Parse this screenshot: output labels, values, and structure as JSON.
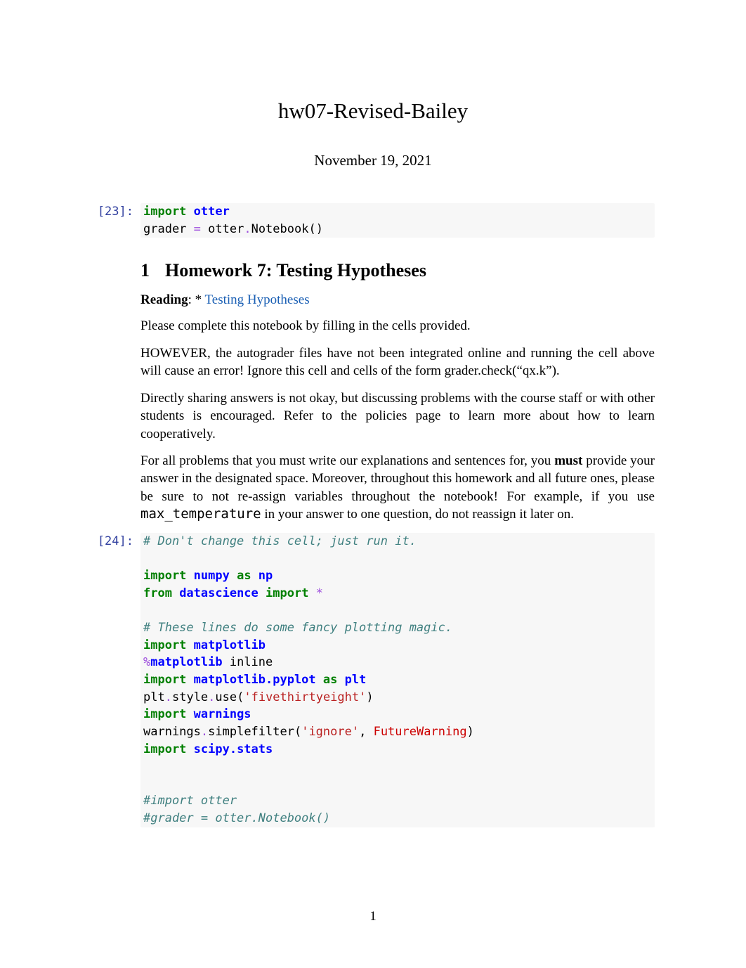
{
  "title": "hw07-Revised-Bailey",
  "date": "November 19, 2021",
  "cells": [
    {
      "prompt": "[23]:",
      "lines": [
        {
          "segs": [
            {
              "t": "import ",
              "c": "kw-green"
            },
            {
              "t": "otter",
              "c": "name-blue"
            }
          ]
        },
        {
          "segs": [
            {
              "t": "grader "
            },
            {
              "t": "=",
              "c": "op-purple"
            },
            {
              "t": " otter"
            },
            {
              "t": ".",
              "c": "op-purple"
            },
            {
              "t": "Notebook()"
            }
          ]
        }
      ]
    },
    {
      "prompt": "[24]:",
      "lines": [
        {
          "segs": [
            {
              "t": "# Don't change this cell; just run it.",
              "c": "comment-it"
            }
          ]
        },
        {
          "segs": [
            {
              "t": ""
            }
          ]
        },
        {
          "segs": [
            {
              "t": "import ",
              "c": "kw-green"
            },
            {
              "t": "numpy ",
              "c": "name-blue"
            },
            {
              "t": "as ",
              "c": "kw-green"
            },
            {
              "t": "np",
              "c": "name-blue"
            }
          ]
        },
        {
          "segs": [
            {
              "t": "from ",
              "c": "kw-green"
            },
            {
              "t": "datascience ",
              "c": "name-blue"
            },
            {
              "t": "import ",
              "c": "kw-green"
            },
            {
              "t": "*",
              "c": "op-purple"
            }
          ]
        },
        {
          "segs": [
            {
              "t": ""
            }
          ]
        },
        {
          "segs": [
            {
              "t": "# These lines do some fancy plotting magic.",
              "c": "comment-it"
            }
          ]
        },
        {
          "segs": [
            {
              "t": "import ",
              "c": "kw-green"
            },
            {
              "t": "matplotlib",
              "c": "name-blue"
            }
          ]
        },
        {
          "segs": [
            {
              "t": "%",
              "c": "op-purple"
            },
            {
              "t": "matplotlib",
              "c": "name-blue"
            },
            {
              "t": " inline"
            }
          ]
        },
        {
          "segs": [
            {
              "t": "import ",
              "c": "kw-green"
            },
            {
              "t": "matplotlib.pyplot ",
              "c": "name-blue"
            },
            {
              "t": "as ",
              "c": "kw-green"
            },
            {
              "t": "plt",
              "c": "name-blue"
            }
          ]
        },
        {
          "segs": [
            {
              "t": "plt"
            },
            {
              "t": ".",
              "c": "op-purple"
            },
            {
              "t": "style"
            },
            {
              "t": ".",
              "c": "op-purple"
            },
            {
              "t": "use("
            },
            {
              "t": "'fivethirtyeight'",
              "c": "str-red"
            },
            {
              "t": ")"
            }
          ]
        },
        {
          "segs": [
            {
              "t": "import ",
              "c": "kw-green"
            },
            {
              "t": "warnings",
              "c": "name-blue"
            }
          ]
        },
        {
          "segs": [
            {
              "t": "warnings"
            },
            {
              "t": ".",
              "c": "op-purple"
            },
            {
              "t": "simplefilter("
            },
            {
              "t": "'ignore'",
              "c": "str-red"
            },
            {
              "t": ", "
            },
            {
              "t": "FutureWarning",
              "c": "exc-red"
            },
            {
              "t": ")"
            }
          ]
        },
        {
          "segs": [
            {
              "t": "import ",
              "c": "kw-green"
            },
            {
              "t": "scipy.stats",
              "c": "name-blue"
            }
          ]
        },
        {
          "segs": [
            {
              "t": ""
            }
          ]
        },
        {
          "segs": [
            {
              "t": ""
            }
          ]
        },
        {
          "segs": [
            {
              "t": "#import otter",
              "c": "comment-it"
            }
          ]
        },
        {
          "segs": [
            {
              "t": "#grader = otter.Notebook()",
              "c": "comment-it"
            }
          ]
        }
      ]
    }
  ],
  "section": {
    "num": "1",
    "title": "Homework 7: Testing Hypotheses"
  },
  "reading": {
    "label": "Reading",
    "prefix": ": * ",
    "link": "Testing Hypotheses"
  },
  "paragraphs": [
    "Please complete this notebook by filling in the cells provided.",
    "HOWEVER, the autograder files have not been integrated online and running the cell above will cause an error! Ignore this cell and cells of the form grader.check(“qx.k”).",
    "Directly sharing answers is not okay, but discussing problems with the course staff or with other students is encouraged. Refer to the policies page to learn more about how to learn cooperatively."
  ],
  "para4": {
    "pre": "For all problems that you must write our explanations and sentences for, you ",
    "bold": "must",
    "mid": " provide your answer in the designated space. Moreover, throughout this homework and all future ones, please be sure to not re-assign variables throughout the notebook! For example, if you use ",
    "mono": "max_temperature",
    "post": " in your answer to one question, do not reassign it later on."
  },
  "page_num": "1"
}
